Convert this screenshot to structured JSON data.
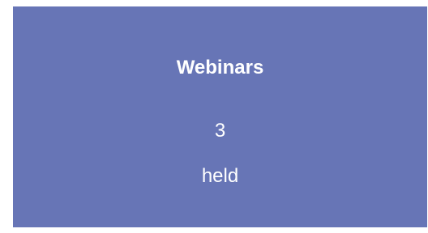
{
  "card": {
    "title": "Webinars",
    "value": "3",
    "unit": "held",
    "background_color": "#6775b6",
    "text_color": "#ffffff"
  }
}
